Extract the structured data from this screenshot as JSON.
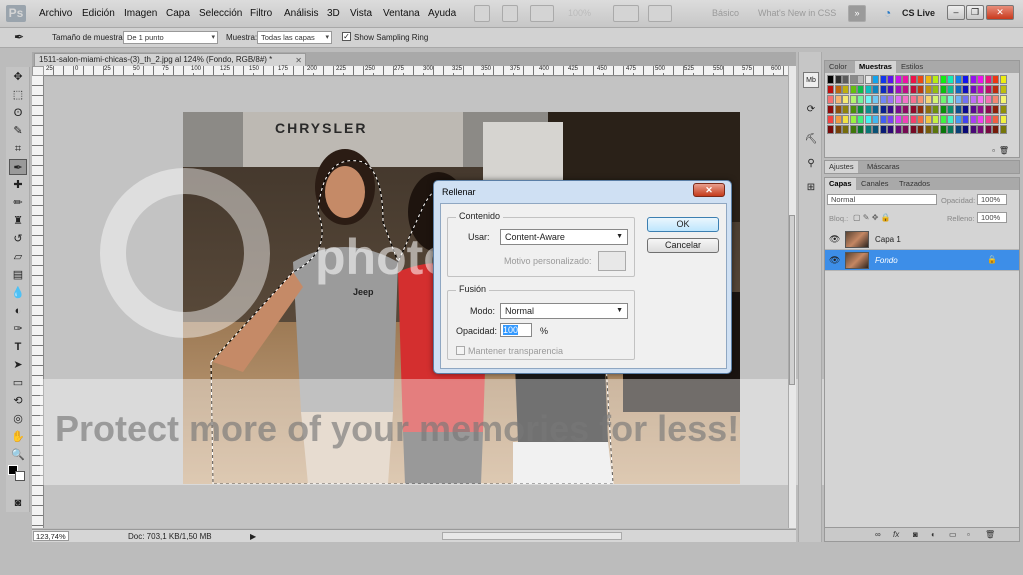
{
  "app": {
    "logo": "Ps"
  },
  "menu": [
    "Archivo",
    "Edición",
    "Imagen",
    "Capa",
    "Selección",
    "Filtro",
    "Análisis",
    "3D",
    "Vista",
    "Ventana",
    "Ayuda"
  ],
  "menubar_right": {
    "zoom": "100%",
    "workspace_basic": "Básico",
    "workspace_new": "What's New in CSS",
    "cs_live": "CS Live"
  },
  "options": {
    "sample_size_label": "Tamaño de muestra:",
    "sample_size_value": "De 1 punto",
    "sample_label": "Muestra:",
    "sample_value": "Todas las capas",
    "show_ring_label": "Show Sampling Ring",
    "show_ring_checked": true
  },
  "document": {
    "tab_title": "1511-salon-miami-chicas-(3)_th_2.jpg al 124% (Fondo, RGB/8#) *",
    "ruler_marks": [
      "25",
      "0",
      "25",
      "50",
      "75",
      "100",
      "125",
      "150",
      "175",
      "200",
      "225",
      "250",
      "275",
      "300",
      "325",
      "350",
      "375",
      "400",
      "425",
      "450",
      "475",
      "500",
      "525",
      "550",
      "575",
      "600",
      "625"
    ],
    "sign_text": "CHRYSLER",
    "shirt_text": "Jeep"
  },
  "status": {
    "zoom": "123,74%",
    "doc": "Doc: 703,1 KB/1,50 MB"
  },
  "panels": {
    "color_tabs": [
      "Color",
      "Muestras",
      "Estilos"
    ],
    "color_active": "Muestras",
    "adjust_tabs": [
      "Ajustes",
      "Máscaras"
    ],
    "layers_tabs": [
      "Capas",
      "Canales",
      "Trazados"
    ],
    "blend_mode": "Normal",
    "opacity_label": "Opacidad:",
    "opacity_value": "100%",
    "lock_label": "Bloq.:",
    "fill_label": "Relleno:",
    "fill_value": "100%",
    "layers": [
      {
        "name": "Capa 1",
        "selected": false
      },
      {
        "name": "Fondo",
        "selected": true
      }
    ]
  },
  "dialog": {
    "title": "Rellenar",
    "content_group": "Contenido",
    "use_label": "Usar:",
    "use_value": "Content-Aware",
    "pattern_label": "Motivo personalizado:",
    "blend_group": "Fusión",
    "mode_label": "Modo:",
    "mode_value": "Normal",
    "opacity_label": "Opacidad:",
    "opacity_value": "100",
    "opacity_unit": "%",
    "preserve_label": "Mantener transparencia",
    "ok_label": "OK",
    "cancel_label": "Cancelar"
  },
  "watermark": {
    "brand": "photobucket",
    "protect": "Protect more of your memories for less!"
  },
  "colors": {
    "selected_layer": "#3d8ee8",
    "dialog_frame": "#cfe0f3"
  }
}
